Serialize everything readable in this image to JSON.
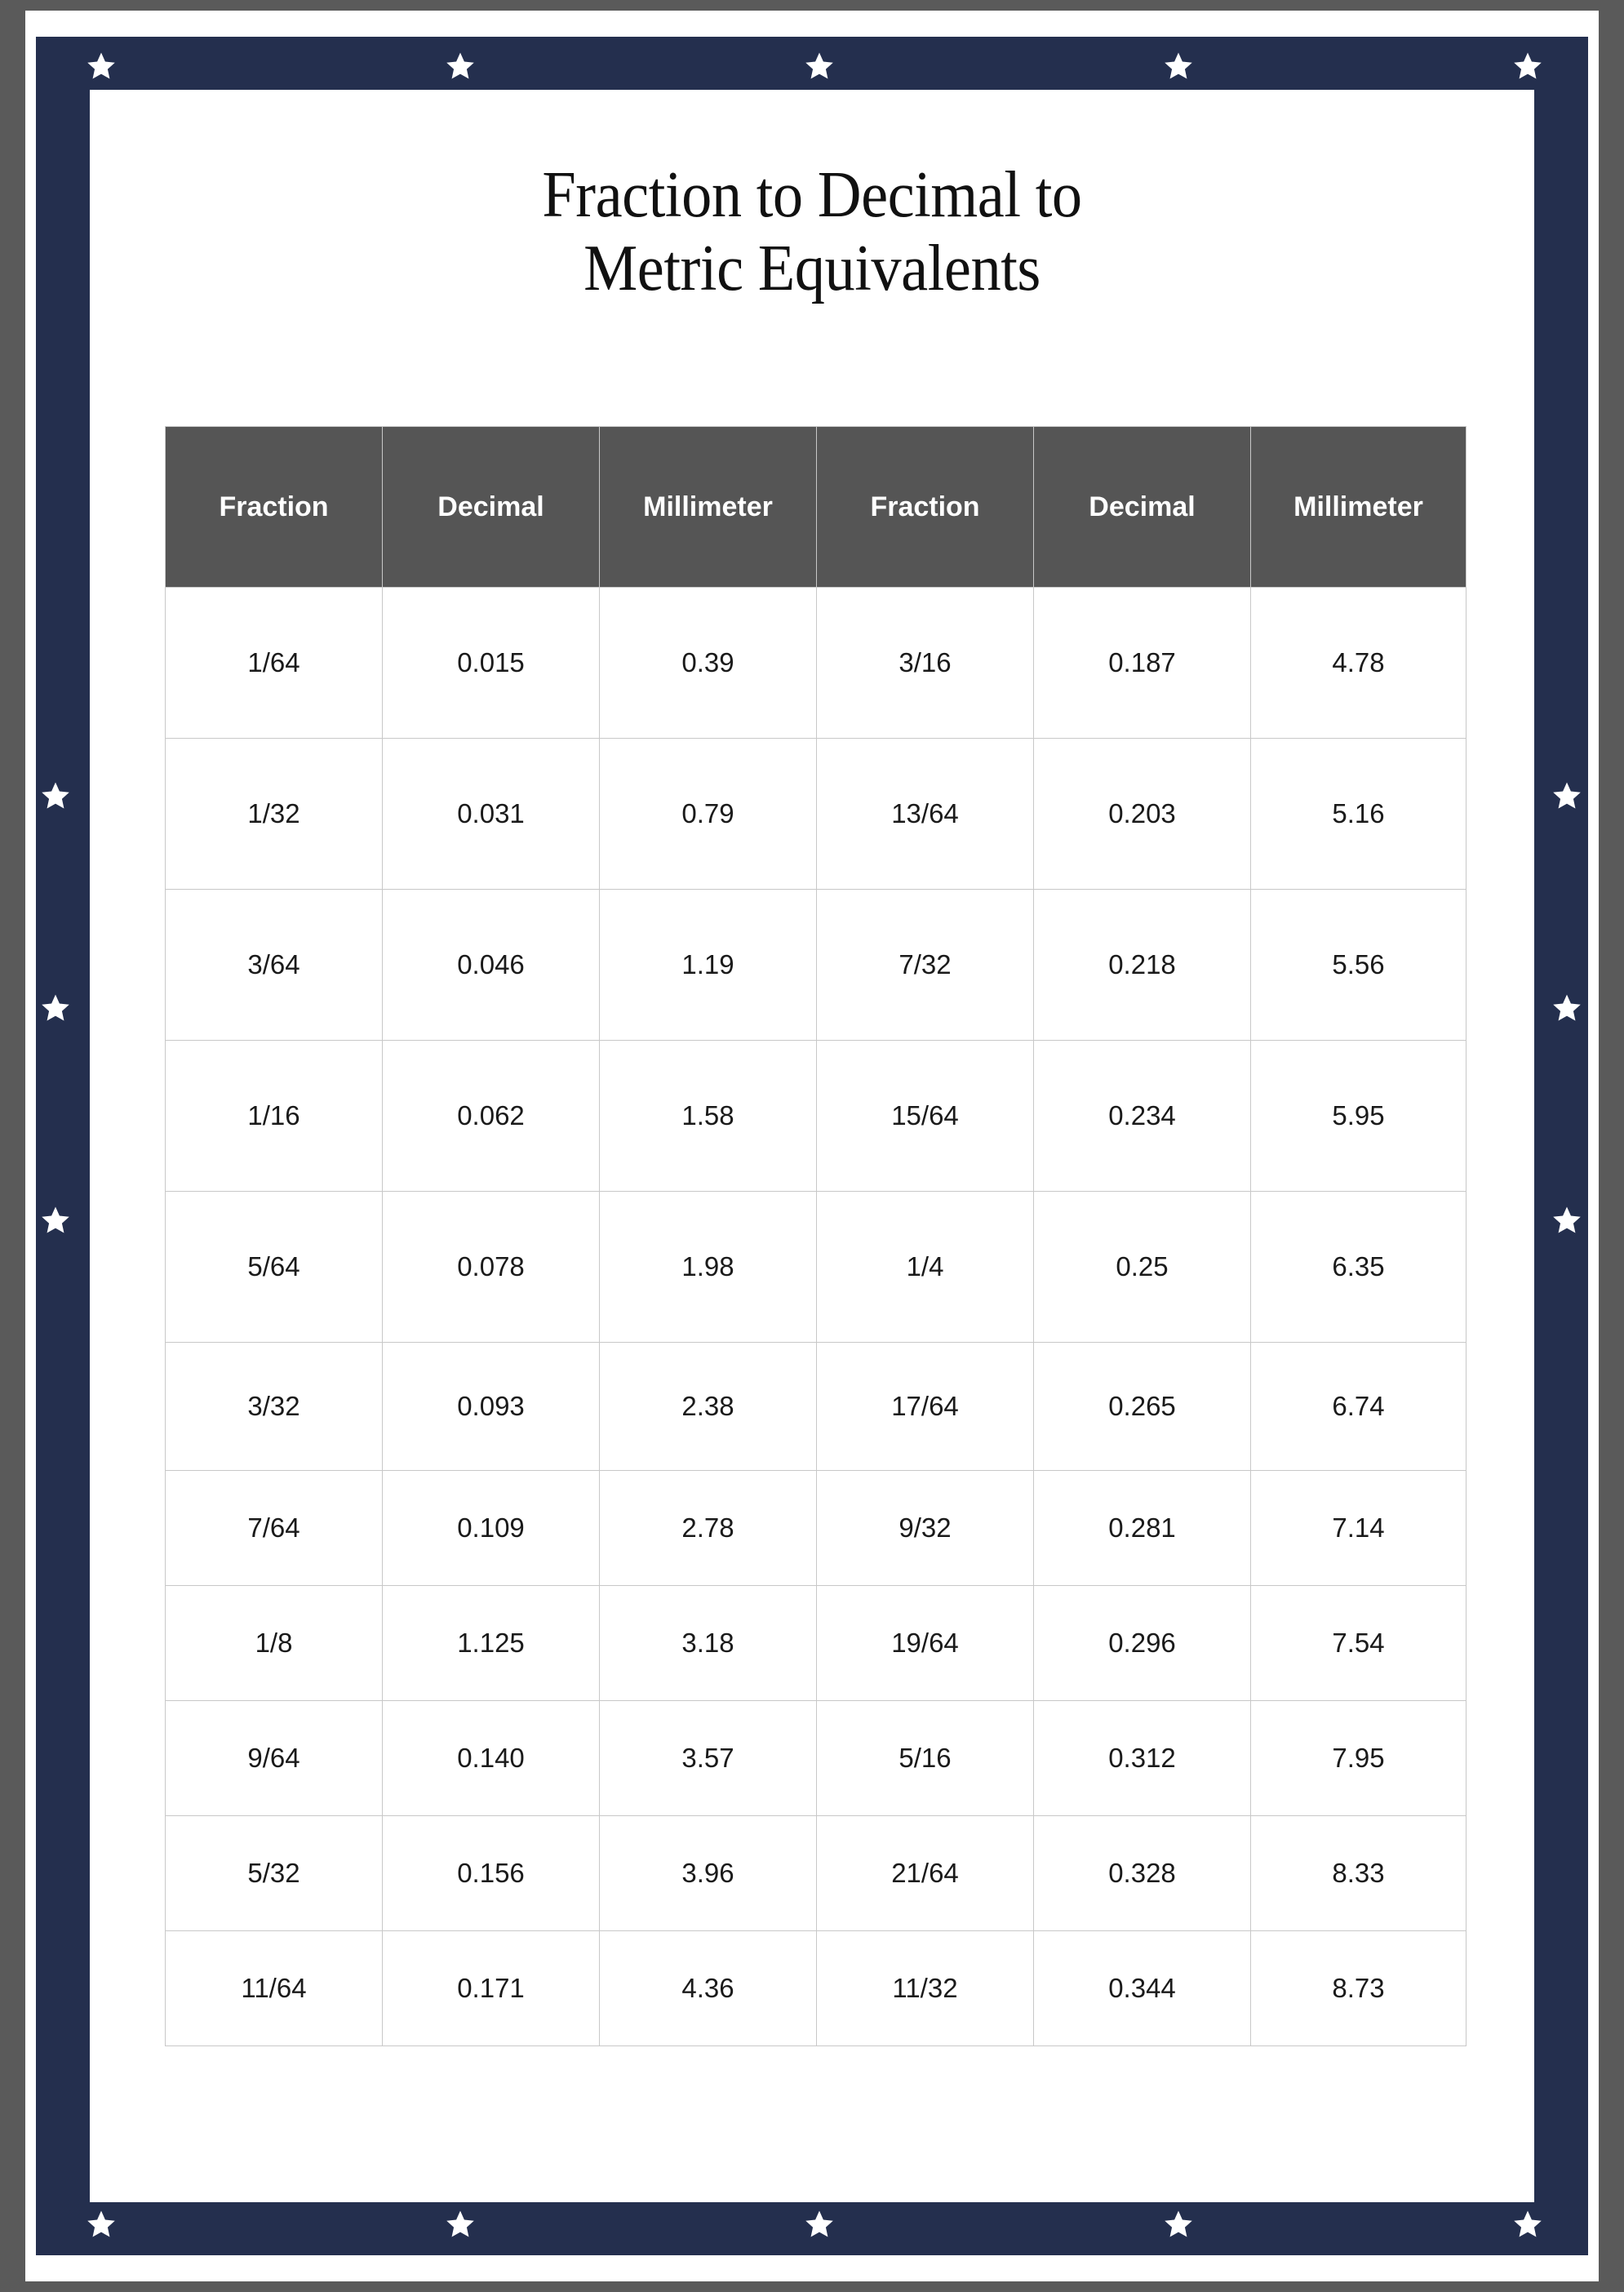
{
  "poster": {
    "title": "Fraction to Decimal to\nMetric Equivalents",
    "colors": {
      "outer_border": "#5a5a5a",
      "frame": "#242f4e",
      "paper": "#ffffff",
      "table_header_bg": "#555555",
      "table_header_text": "#ffffff",
      "grid_line": "#c8c8c8",
      "star": "#ffffff"
    },
    "decorations": {
      "star_icon": "star-icon",
      "top_star_count": 5,
      "bottom_star_count": 5,
      "left_star_count": 3,
      "right_star_count": 3
    }
  },
  "table": {
    "headers": [
      "Fraction",
      "Decimal",
      "Millimeter",
      "Fraction",
      "Decimal",
      "Millimeter"
    ],
    "rows": [
      [
        "1/64",
        "0.015",
        "0.39",
        "3/16",
        "0.187",
        "4.78"
      ],
      [
        "1/32",
        "0.031",
        "0.79",
        "13/64",
        "0.203",
        "5.16"
      ],
      [
        "3/64",
        "0.046",
        "1.19",
        "7/32",
        "0.218",
        "5.56"
      ],
      [
        "1/16",
        "0.062",
        "1.58",
        "15/64",
        "0.234",
        "5.95"
      ],
      [
        "5/64",
        "0.078",
        "1.98",
        "1/4",
        "0.25",
        "6.35"
      ],
      [
        "3/32",
        "0.093",
        "2.38",
        "17/64",
        "0.265",
        "6.74"
      ],
      [
        "7/64",
        "0.109",
        "2.78",
        "9/32",
        "0.281",
        "7.14"
      ],
      [
        "1/8",
        "1.125",
        "3.18",
        "19/64",
        "0.296",
        "7.54"
      ],
      [
        "9/64",
        "0.140",
        "3.57",
        "5/16",
        "0.312",
        "7.95"
      ],
      [
        "5/32",
        "0.156",
        "3.96",
        "21/64",
        "0.328",
        "8.33"
      ],
      [
        "11/64",
        "0.171",
        "4.36",
        "11/32",
        "0.344",
        "8.73"
      ]
    ]
  },
  "chart_data": {
    "type": "table",
    "title": "Fraction to Decimal to Metric Equivalents",
    "columns": [
      "Fraction",
      "Decimal",
      "Millimeter",
      "Fraction",
      "Decimal",
      "Millimeter"
    ],
    "rows": [
      [
        "1/64",
        "0.015",
        "0.39",
        "3/16",
        "0.187",
        "4.78"
      ],
      [
        "1/32",
        "0.031",
        "0.79",
        "13/64",
        "0.203",
        "5.16"
      ],
      [
        "3/64",
        "0.046",
        "1.19",
        "7/32",
        "0.218",
        "5.56"
      ],
      [
        "1/16",
        "0.062",
        "1.58",
        "15/64",
        "0.234",
        "5.95"
      ],
      [
        "5/64",
        "0.078",
        "1.98",
        "1/4",
        "0.25",
        "6.35"
      ],
      [
        "3/32",
        "0.093",
        "2.38",
        "17/64",
        "0.265",
        "6.74"
      ],
      [
        "7/64",
        "0.109",
        "2.78",
        "9/32",
        "0.281",
        "7.14"
      ],
      [
        "1/8",
        "1.125",
        "3.18",
        "19/64",
        "0.296",
        "7.54"
      ],
      [
        "9/64",
        "0.140",
        "3.57",
        "5/16",
        "0.312",
        "7.95"
      ],
      [
        "5/32",
        "0.156",
        "3.96",
        "21/64",
        "0.328",
        "8.33"
      ],
      [
        "11/64",
        "0.171",
        "4.36",
        "11/32",
        "0.344",
        "8.73"
      ]
    ]
  }
}
